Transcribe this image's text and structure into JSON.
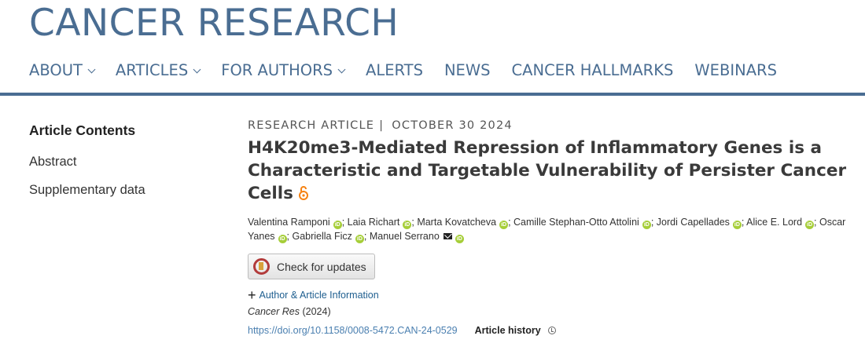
{
  "site": {
    "title": "CANCER RESEARCH"
  },
  "nav": [
    {
      "label": "ABOUT",
      "dropdown": true
    },
    {
      "label": "ARTICLES",
      "dropdown": true
    },
    {
      "label": "FOR AUTHORS",
      "dropdown": true
    },
    {
      "label": "ALERTS",
      "dropdown": false
    },
    {
      "label": "NEWS",
      "dropdown": false
    },
    {
      "label": "CANCER HALLMARKS",
      "dropdown": false
    },
    {
      "label": "WEBINARS",
      "dropdown": false
    }
  ],
  "sidebar": {
    "heading": "Article Contents",
    "links": [
      "Abstract",
      "Supplementary data"
    ]
  },
  "article": {
    "type": "RESEARCH ARTICLE",
    "separator": "|",
    "date": "OCTOBER 30 2024",
    "title": "H4K20me3-Mediated Repression of Inflammatory Genes is a Characteristic and Targetable Vulnerability of Persister Cancer Cells",
    "authors": [
      {
        "name": "Valentina Ramponi",
        "orcid": true,
        "email": false
      },
      {
        "name": "Laia Richart",
        "orcid": true,
        "email": false
      },
      {
        "name": "Marta Kovatcheva",
        "orcid": true,
        "email": false
      },
      {
        "name": "Camille Stephan-Otto Attolini",
        "orcid": true,
        "email": false
      },
      {
        "name": "Jordi Capellades",
        "orcid": true,
        "email": false
      },
      {
        "name": "Alice E. Lord",
        "orcid": true,
        "email": false
      },
      {
        "name": "Oscar Yanes",
        "orcid": true,
        "email": false
      },
      {
        "name": "Gabriella Ficz",
        "orcid": true,
        "email": false
      },
      {
        "name": "Manuel Serrano",
        "orcid": true,
        "email": true
      }
    ],
    "check_updates_label": "Check for updates",
    "author_info_label": "Author & Article Information",
    "journal": "Cancer Res",
    "year": "(2024)",
    "doi": "https://doi.org/10.1158/0008-5472.CAN-24-0529",
    "history_label": "Article history"
  },
  "colors": {
    "brand": "#4a6d92",
    "orcid": "#a6ce39",
    "open_access": "#f68212",
    "link": "#1e5e8f"
  }
}
